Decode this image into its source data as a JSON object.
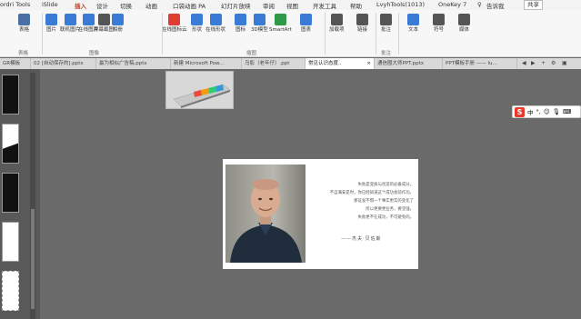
{
  "ribbon_tabs": [
    "ordri Tools",
    "iSlide",
    "插入",
    "设计",
    "切换",
    "动画",
    "口袋动画 PA",
    "幻灯片放映",
    "审阅",
    "视图",
    "开发工具",
    "帮助",
    "LvyhTools(1013)",
    "OneKey 7",
    "♀",
    "告诉我"
  ],
  "share_label": "共享",
  "ribbon_buttons": [
    {
      "label": "表格",
      "icon": "table-icon",
      "color": "#4a6fa5"
    },
    {
      "label": "图片",
      "icon": "picture-icon",
      "color": "#3a7bd5"
    },
    {
      "label": "联机图片",
      "icon": "online-picture-icon",
      "color": "#3a7bd5"
    },
    {
      "label": "在线图片",
      "icon": "online-image-icon",
      "color": "#3a7bd5"
    },
    {
      "label": "屏幕截图",
      "icon": "screenshot-icon",
      "color": "#555555"
    },
    {
      "label": "相册",
      "icon": "album-icon",
      "color": "#3a7bd5"
    },
    {
      "label": "在线图标云",
      "icon": "icon-cloud-icon",
      "color": "#e03c31"
    },
    {
      "label": "形状",
      "icon": "shapes-icon",
      "color": "#3a7bd5"
    },
    {
      "label": "在线形状",
      "icon": "online-shapes-icon",
      "color": "#3a7bd5"
    },
    {
      "label": "图标",
      "icon": "icons-icon",
      "color": "#3a7bd5"
    },
    {
      "label": "3D模型",
      "icon": "3d-model-icon",
      "color": "#3a7bd5"
    },
    {
      "label": "SmartArt",
      "icon": "smartart-icon",
      "color": "#2e9a48"
    },
    {
      "label": "图表",
      "icon": "chart-icon",
      "color": "#3a7bd5"
    },
    {
      "label": "加载项",
      "icon": "addins-icon",
      "color": "#555555"
    },
    {
      "label": "链接",
      "icon": "link-icon",
      "color": "#555555"
    },
    {
      "label": "批注",
      "icon": "comment-icon",
      "color": "#555555"
    },
    {
      "label": "文本",
      "icon": "text-icon",
      "color": "#3a7bd5"
    },
    {
      "label": "符号",
      "icon": "symbol-icon",
      "color": "#555555"
    },
    {
      "label": "媒体",
      "icon": "media-icon",
      "color": "#555555"
    }
  ],
  "ribbon_groups": [
    "表格",
    "图像",
    "插图",
    "批注"
  ],
  "doc_tabs": [
    "GR模板",
    "02 [自动保存的].pptx",
    "最为相似广告稿.pptx",
    "新建 Microsoft Pow...",
    "乌影（老年仔）.ppt",
    "常见认识态度..",
    "通信圈大师PPT.pptx",
    "PPT模板手册 —— lu..."
  ],
  "active_doc_tab_index": 5,
  "ime_label": "中",
  "slide": {
    "quote_lines": [
      "失败是变质与创造的必备成分。",
      "不自满安是时，你已经知道这个成功会前作功。",
      "那证发不惧一个事实更实的变化了",
      "所以更要更业务，要坚强。",
      "失败更不在成功，不可避免的。"
    ],
    "signature": "——杰夫·贝佐斯"
  },
  "colors": {
    "accent": "#c4402c",
    "background": "#6a6a6a"
  }
}
